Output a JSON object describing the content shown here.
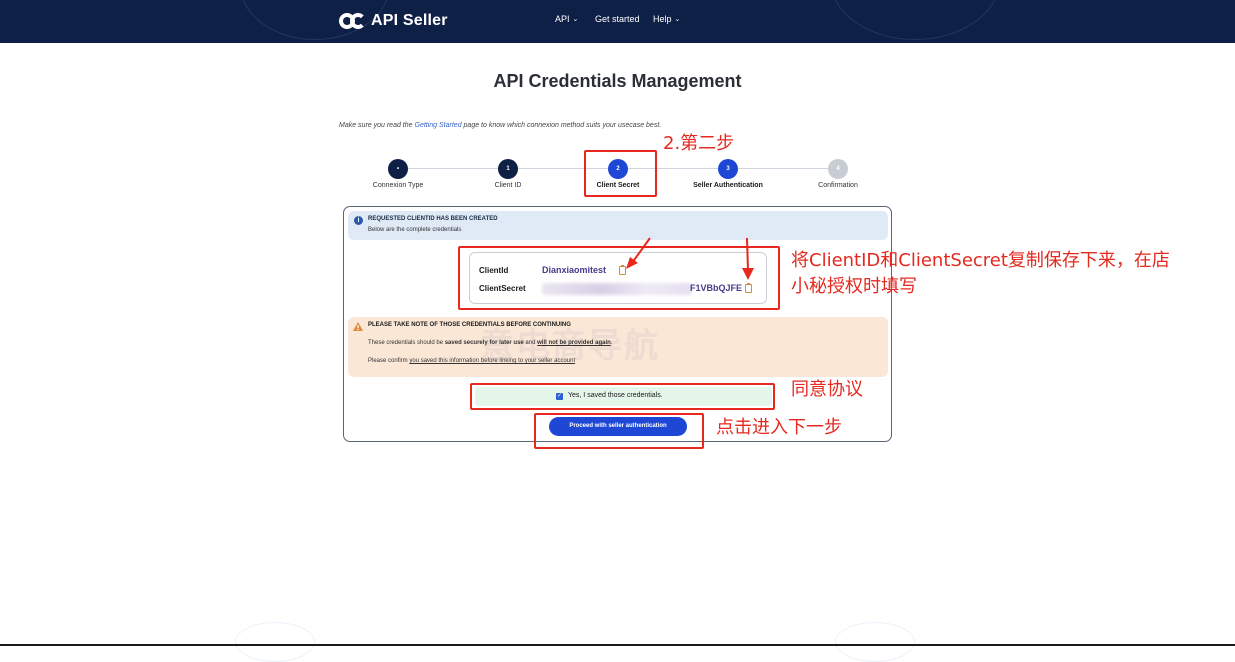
{
  "header": {
    "brand": "API Seller",
    "nav": [
      {
        "label": "API",
        "has_dropdown": true
      },
      {
        "label": "Get started",
        "has_dropdown": false
      },
      {
        "label": "Help",
        "has_dropdown": true
      }
    ],
    "background_color": "#0f2047"
  },
  "page": {
    "title": "API Credentials Management",
    "intro_prefix": "Make sure you read the ",
    "intro_link": "Getting Started",
    "intro_suffix": " page to know which connexion method suits your usecase best."
  },
  "stepper": {
    "steps": [
      {
        "number": "•",
        "label": "Connexion Type",
        "state": "done"
      },
      {
        "number": "1",
        "label": "Client ID",
        "state": "done"
      },
      {
        "number": "2",
        "label": "Client Secret",
        "state": "current"
      },
      {
        "number": "3",
        "label": "Seller Authentication",
        "state": "next"
      },
      {
        "number": "4",
        "label": "Confirmation",
        "state": "pending"
      }
    ],
    "colors": {
      "done": "#0f2047",
      "current": "#1e47d6",
      "next": "#1e47d6",
      "pending": "#c8ccd3"
    }
  },
  "info": {
    "title": "REQUESTED CLIENTID HAS BEEN CREATED",
    "subtitle": "Below are the complete credentials"
  },
  "credentials": {
    "client_id_label": "ClientId",
    "client_id_value": "Dianxiaomitest",
    "client_secret_label": "ClientSecret",
    "client_secret_visible_suffix": "F1VBbQJFE"
  },
  "warning": {
    "title": "PLEASE TAKE NOTE OF THOSE CREDENTIALS BEFORE CONTINUING",
    "line1_a": "These credentials should be ",
    "line1_b": "saved securely for later use",
    "line1_c": " and ",
    "line1_d": "will not be provided again",
    "line1_e": ".",
    "line2_a": "Please confirm ",
    "line2_b": "you saved this information before linking to your seller account"
  },
  "watermark": "意电商导航",
  "confirm": {
    "checked": true,
    "label": "Yes, I saved those credentials."
  },
  "proceed_label": "Proceed with seller authentication",
  "annotations": {
    "step2": "2.第二步",
    "copy_note_line1": "将ClientID和ClientSecret复制保存下来，在店",
    "copy_note_line2": "小秘授权时填写",
    "agree": "同意协议",
    "next": "点击进入下一步",
    "color": "#e8281e"
  }
}
